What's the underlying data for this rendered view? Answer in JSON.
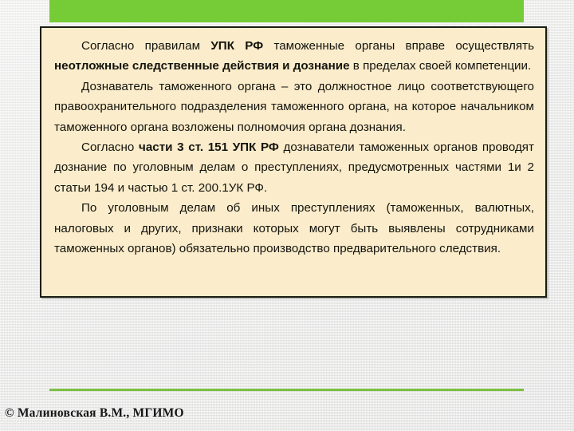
{
  "slide": {
    "header_bar": {
      "color": "#76cc36"
    },
    "content_box": {
      "background": "#fbeccb",
      "border_color": "#1c1c14",
      "paragraphs": [
        {
          "id": "p1",
          "runs": [
            {
              "text": "Согласно правилам ",
              "bold": false
            },
            {
              "text": "УПК РФ",
              "bold": true
            },
            {
              "text": " таможенные органы вправе осуществлять ",
              "bold": false
            },
            {
              "text": "неотложные следственные действия и дознание",
              "bold": true
            },
            {
              "text": " в пределах своей компетенции.",
              "bold": false
            }
          ]
        },
        {
          "id": "p2",
          "runs": [
            {
              "text": "Дознаватель таможенного органа – это должностное лицо соответствующего правоохранительного подразделения таможенного органа, на которое начальником таможенного органа возложены полномочия органа дознания.",
              "bold": false
            }
          ]
        },
        {
          "id": "p3",
          "runs": [
            {
              "text": "Согласно ",
              "bold": false
            },
            {
              "text": "части 3 ст. 151 УПК РФ",
              "bold": true
            },
            {
              "text": " дознаватели таможенных органов проводят дознание по уголовным делам о преступлениях, предусмотренных частями 1и 2 статьи  194 и частью 1 ст. 200.1УК РФ.",
              "bold": false
            }
          ]
        },
        {
          "id": "p4",
          "runs": [
            {
              "text": "По уголовным делам об иных преступлениях (таможенных, валютных, налоговых и других, признаки которых могут быть выявлены сотрудниками таможенных органов) обязательно производство предварительного следствия.",
              "bold": false
            }
          ]
        }
      ]
    },
    "footer_rule": {
      "color": "#7cc142"
    },
    "copyright": "© Малиновская В.М., МГИМО"
  }
}
